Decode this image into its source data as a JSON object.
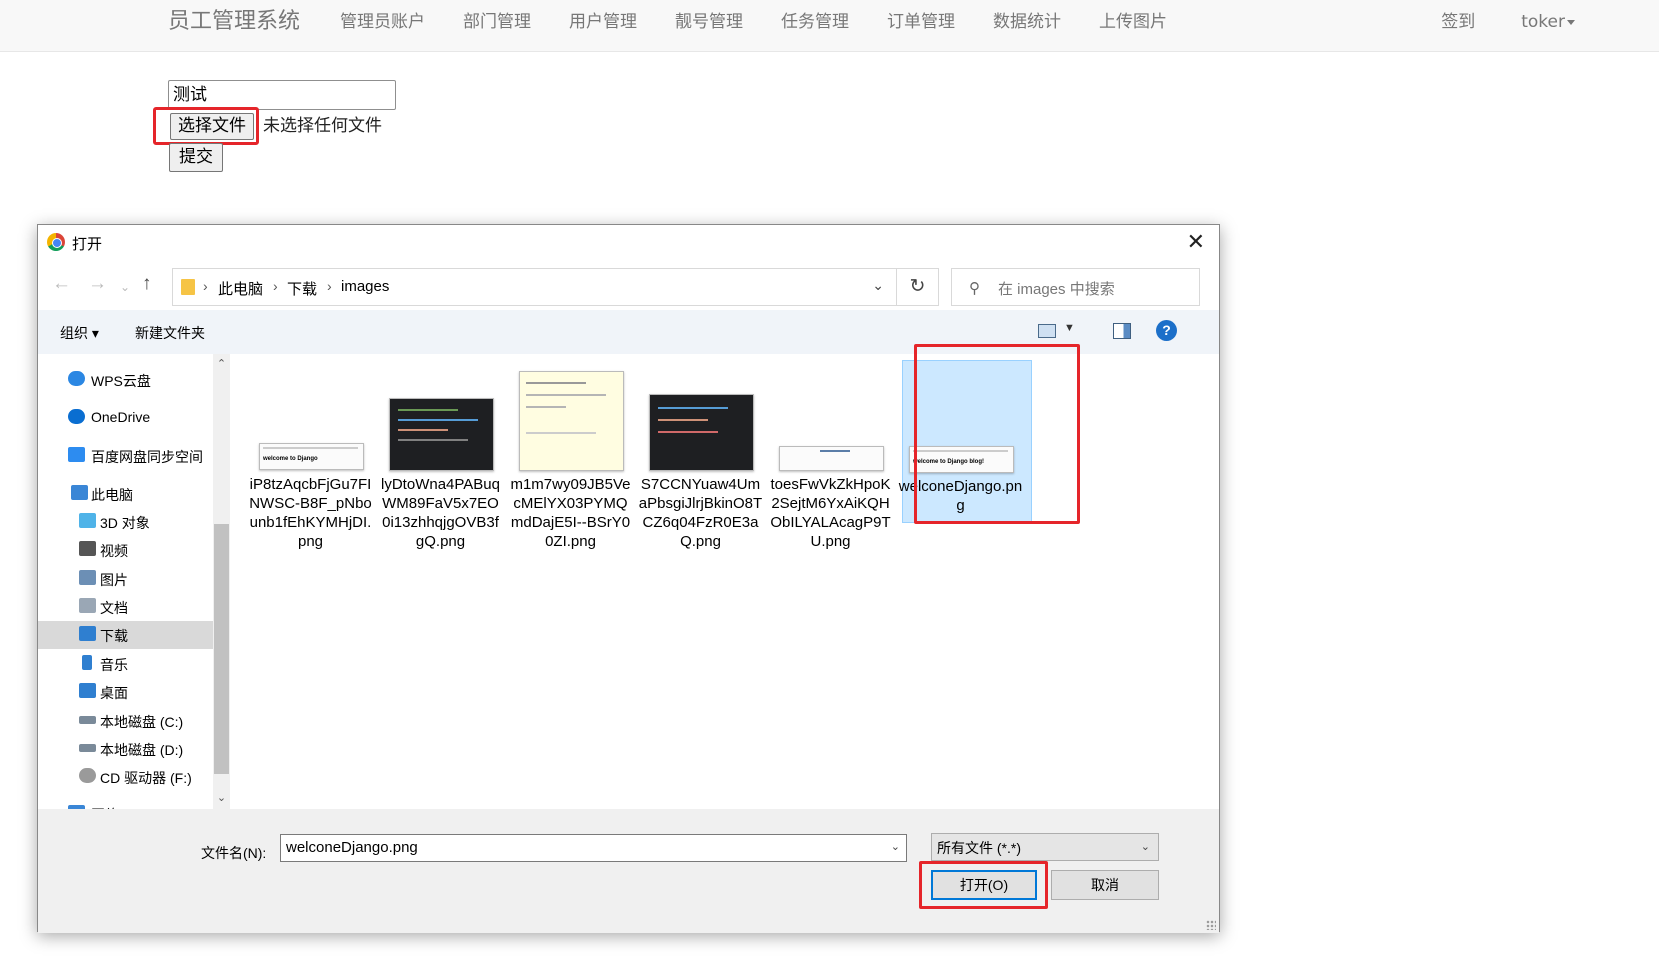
{
  "navbar": {
    "brand": "员工管理系统",
    "items": [
      "管理员账户",
      "部门管理",
      "用户管理",
      "靓号管理",
      "任务管理",
      "订单管理",
      "数据统计",
      "上传图片"
    ],
    "right": {
      "checkin": "签到",
      "user": "toker"
    }
  },
  "form": {
    "text_value": "测试",
    "file_button": "选择文件",
    "file_status": "未选择任何文件",
    "submit": "提交"
  },
  "dialog": {
    "title": "打开",
    "breadcrumb": [
      "此电脑",
      "下载",
      "images"
    ],
    "search_placeholder": "在 images 中搜索",
    "toolbar": {
      "organize": "组织 ▾",
      "new_folder": "新建文件夹"
    },
    "sidebar": [
      {
        "label": "WPS云盘",
        "icon": "cloud-icon",
        "color": "#2b87e3"
      },
      {
        "label": "OneDrive",
        "icon": "onedrive-icon",
        "color": "#0a6ed1"
      },
      {
        "label": "百度网盘同步空间",
        "icon": "baidu-icon",
        "color": "#2d8cf0"
      },
      {
        "label": "此电脑",
        "icon": "computer-icon",
        "color": "#3a86d6"
      },
      {
        "label": "3D 对象",
        "icon": "cube-icon",
        "color": "#4fb3e8"
      },
      {
        "label": "视频",
        "icon": "video-icon",
        "color": "#555555"
      },
      {
        "label": "图片",
        "icon": "picture-icon",
        "color": "#6c8fb5"
      },
      {
        "label": "文档",
        "icon": "document-icon",
        "color": "#9aa7b5"
      },
      {
        "label": "下载",
        "icon": "download-icon",
        "color": "#2f7fd0",
        "selected": true
      },
      {
        "label": "音乐",
        "icon": "music-icon",
        "color": "#2f7fd0"
      },
      {
        "label": "桌面",
        "icon": "desktop-icon",
        "color": "#2f7fd0"
      },
      {
        "label": "本地磁盘 (C:)",
        "icon": "drive-icon",
        "color": "#7a8a99"
      },
      {
        "label": "本地磁盘 (D:)",
        "icon": "drive-icon",
        "color": "#7a8a99"
      },
      {
        "label": "CD 驱动器 (F:)",
        "icon": "cd-icon",
        "color": "#9a9a9a"
      },
      {
        "label": "网络",
        "icon": "network-icon",
        "color": "#3a86d6"
      }
    ],
    "files": [
      {
        "name": "iP8tzAqcbFjGu7FINWSC-B8F_pNbounb1fEhKYMHjDI.png",
        "thumb": "light",
        "caption": "welcome to Django"
      },
      {
        "name": "lyDtoWna4PABuqWM89FaV5x7EO0i13zhhqjgOVB3fgQ.png",
        "thumb": "dark",
        "caption": ""
      },
      {
        "name": "m1m7wy09JB5VecMElYX03PYMQmdDajE5I--BSrY00ZI.png",
        "thumb": "yellow",
        "caption": ""
      },
      {
        "name": "S7CCNYuaw4UmaPbsgiJlrjBkinO8TCZ6q04FzR0E3aQ.png",
        "thumb": "dark",
        "caption": ""
      },
      {
        "name": "toesFwVkZkHpoK2SejtM6YxAiKQHObILYALAcagP9TU.png",
        "thumb": "light",
        "caption": ""
      },
      {
        "name": "welconeDjango.png",
        "thumb": "light",
        "caption": "welcome to Django blog!",
        "selected": true
      }
    ],
    "filename_label": "文件名(N):",
    "filename_value": "welconeDjango.png",
    "filetype": "所有文件 (*.*)",
    "open_button": "打开(O)",
    "cancel_button": "取消"
  },
  "colors": {
    "highlight": "#e5252a",
    "selection": "#cce8ff",
    "accent": "#0078d7"
  }
}
